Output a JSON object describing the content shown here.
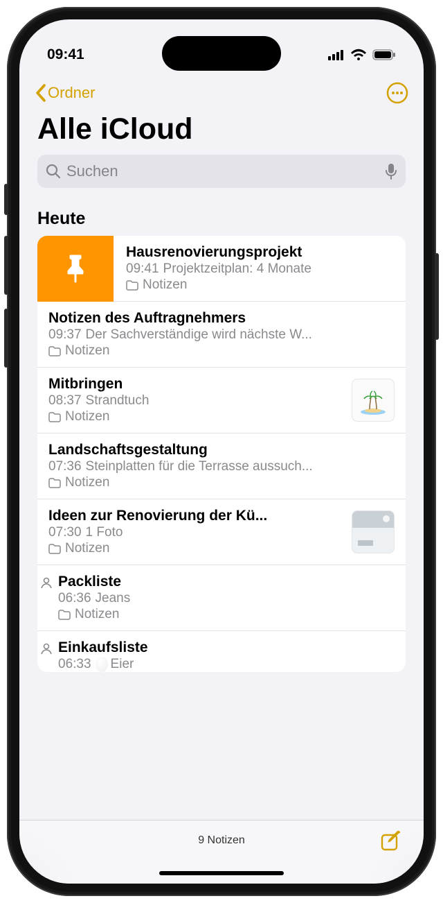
{
  "statusBar": {
    "time": "09:41"
  },
  "nav": {
    "back": "Ordner"
  },
  "title": "Alle iCloud",
  "search": {
    "placeholder": "Suchen"
  },
  "sectionHeader": "Heute",
  "folderLabel": "Notizen",
  "notes": [
    {
      "title": "Hausrenovierungsprojekt",
      "time": "09:41",
      "preview": "Projektzeitplan: 4 Monate"
    },
    {
      "title": "Notizen des Auftragnehmers",
      "time": "09:37",
      "preview": "Der Sachverständige wird nächste W..."
    },
    {
      "title": "Mitbringen",
      "time": "08:37",
      "preview": "Strandtuch"
    },
    {
      "title": "Landschaftsgestaltung",
      "time": "07:36",
      "preview": "Steinplatten für die Terrasse aussuch..."
    },
    {
      "title": "Ideen zur Renovierung der Kü...",
      "time": "07:30",
      "preview": "1 Foto"
    },
    {
      "title": "Packliste",
      "time": "06:36",
      "preview": "Jeans"
    },
    {
      "title": "Einkaufsliste",
      "time": "06:33",
      "preview": "Eier"
    }
  ],
  "footer": {
    "count": "9 Notizen"
  }
}
